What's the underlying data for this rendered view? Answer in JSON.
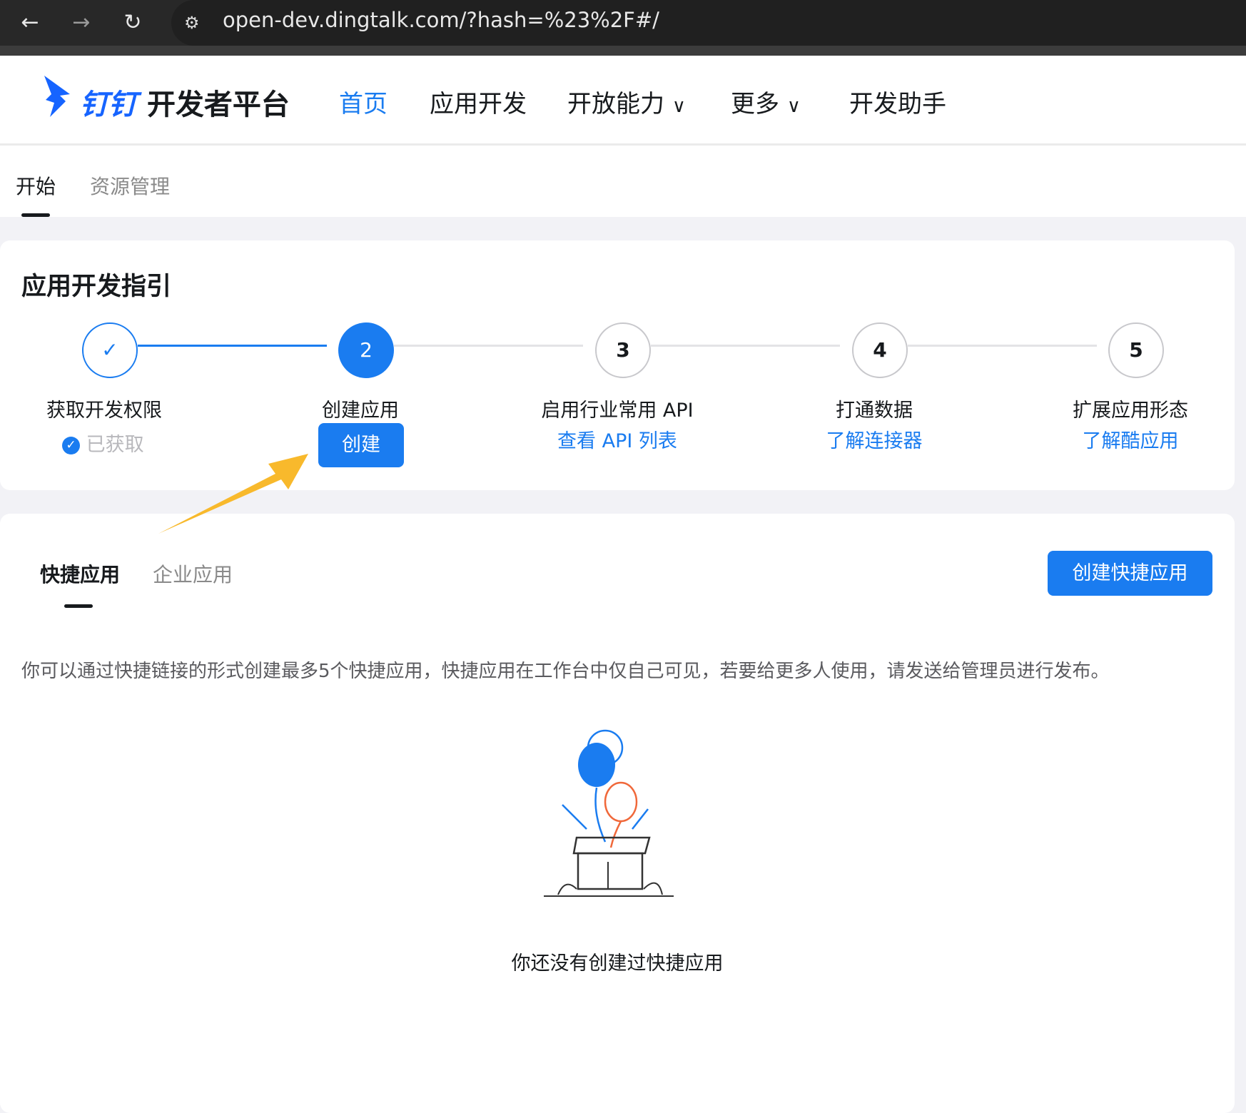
{
  "browser": {
    "url": "open-dev.dingtalk.com/?hash=%23%2F#/"
  },
  "header": {
    "logo_ding": "钉钉",
    "logo_title": "开发者平台",
    "nav": [
      {
        "label": "首页",
        "active": true
      },
      {
        "label": "应用开发"
      },
      {
        "label": "开放能力",
        "dropdown": true
      },
      {
        "label": "更多",
        "dropdown": true
      },
      {
        "label": "开发助手"
      }
    ]
  },
  "subtabs": [
    {
      "label": "开始",
      "active": true
    },
    {
      "label": "资源管理"
    }
  ],
  "guide": {
    "title": "应用开发指引",
    "steps": [
      {
        "number": "1",
        "label": "获取开发权限",
        "status": "已获取",
        "state": "done"
      },
      {
        "number": "2",
        "label": "创建应用",
        "button": "创建",
        "state": "current"
      },
      {
        "number": "3",
        "label": "启用行业常用 API",
        "link": "查看 API 列表"
      },
      {
        "number": "4",
        "label": "打通数据",
        "link": "了解连接器"
      },
      {
        "number": "5",
        "label": "扩展应用形态",
        "link": "了解酷应用"
      }
    ]
  },
  "apps": {
    "tabs": [
      {
        "label": "快捷应用",
        "active": true
      },
      {
        "label": "企业应用"
      }
    ],
    "create_button": "创建快捷应用",
    "description": "你可以通过快捷链接的形式创建最多5个快捷应用，快捷应用在工作台中仅自己可见，若要给更多人使用，请发送给管理员进行发布。",
    "empty_text": "你还没有创建过快捷应用"
  },
  "colors": {
    "accent": "#1a7cf0",
    "annotation_arrow": "#f8b92c"
  }
}
